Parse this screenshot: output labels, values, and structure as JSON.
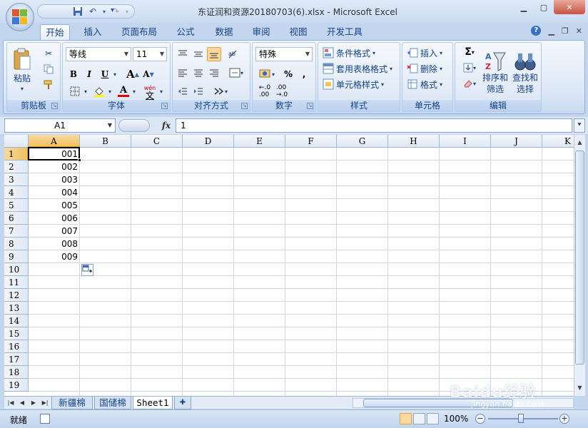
{
  "window": {
    "title": "东证润和资源20180703(6).xlsx - Microsoft Excel"
  },
  "ribbon_tabs": [
    "开始",
    "插入",
    "页面布局",
    "公式",
    "数据",
    "审阅",
    "视图",
    "开发工具"
  ],
  "active_tab": "开始",
  "clipboard": {
    "paste_label": "粘贴",
    "group_label": "剪贴板"
  },
  "font": {
    "name": "等线",
    "size": "11",
    "bold": "B",
    "italic": "I",
    "underline": "U",
    "color_letter": "A",
    "wen_label": "wén",
    "wen_char": "文",
    "group_label": "字体"
  },
  "alignment": {
    "group_label": "对齐方式"
  },
  "number": {
    "format": "特殊",
    "percent": "%",
    "comma": ",",
    "group_label": "数字"
  },
  "styles": {
    "conditional": "条件格式",
    "table_format": "套用表格格式",
    "cell_styles": "单元格样式",
    "group_label": "样式"
  },
  "cells": {
    "insert": "插入",
    "delete": "删除",
    "format": "格式",
    "group_label": "单元格"
  },
  "editing": {
    "sort_filter_line1": "排序和",
    "sort_filter_line2": "筛选",
    "find_select_line1": "查找和",
    "find_select_line2": "选择",
    "group_label": "编辑"
  },
  "formula_bar": {
    "name_box": "A1",
    "fx": "fx",
    "formula": "1"
  },
  "columns": [
    "A",
    "B",
    "C",
    "D",
    "E",
    "F",
    "G",
    "H",
    "I",
    "J",
    "K"
  ],
  "rows": [
    "1",
    "2",
    "3",
    "4",
    "5",
    "6",
    "7",
    "8",
    "9",
    "10",
    "11",
    "12",
    "13",
    "14",
    "15",
    "16",
    "17",
    "18",
    "19"
  ],
  "column_a_values": [
    "001",
    "002",
    "003",
    "004",
    "005",
    "006",
    "007",
    "008",
    "009"
  ],
  "sheet_tabs": [
    "新疆棉",
    "国储棉",
    "Sheet1"
  ],
  "active_sheet": "Sheet1",
  "status": {
    "ready": "就绪",
    "zoom": "100%"
  },
  "watermark": {
    "text": "Baidu经验",
    "url": "jingyan.baidu.com"
  },
  "colors": {
    "accent": "#15428b",
    "selection_header": "#f1c15f",
    "close_button": "#c75343"
  }
}
